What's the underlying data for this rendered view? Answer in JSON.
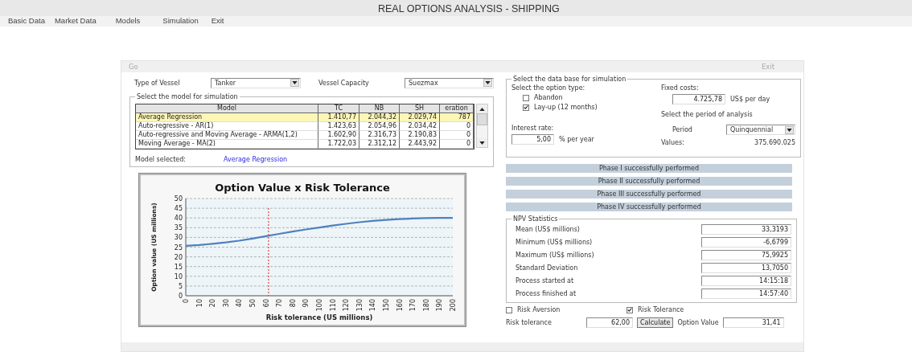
{
  "window": {
    "title": "REAL OPTIONS ANALYSIS - SHIPPING"
  },
  "menu": [
    "Basic Data",
    "Market Data",
    "Models",
    "Simulation",
    "Exit"
  ],
  "toolbar": {
    "go": "Go",
    "exit": "Exit"
  },
  "vessel": {
    "type_label": "Type of Vessel",
    "type_value": "Tanker",
    "capacity_label": "Vessel Capacity",
    "capacity_value": "Suezmax"
  },
  "model_group": {
    "title": "Select the model for simulation",
    "columns": [
      "Model",
      "TC",
      "NB",
      "SH",
      "eration"
    ],
    "rows": [
      {
        "cells": [
          "Average Regression",
          "1.410,77",
          "2.044,32",
          "2.029,74",
          "787"
        ],
        "selected": true
      },
      {
        "cells": [
          "Auto-regressive  -  AR(1)",
          "1.423,63",
          "2.054,96",
          "2.034,42",
          "0"
        ],
        "selected": false
      },
      {
        "cells": [
          "Auto-regressive and Moving Average -  ARMA(1,2)",
          "1.602,90",
          "2.316,73",
          "2.190,83",
          "0"
        ],
        "selected": false
      },
      {
        "cells": [
          "Moving Average  -  MA(2)",
          "1.722,03",
          "2.312,12",
          "2.443,92",
          "0"
        ],
        "selected": false
      }
    ],
    "selected_label": "Model selected:",
    "selected_value": "Average Regression"
  },
  "chart": {
    "chart_data": {
      "type": "line",
      "title": "Option Value x Risk Tolerance",
      "xlabel": "Risk tolerance (US millions)",
      "ylabel": "Option value (US millions)",
      "x": [
        0,
        10,
        20,
        30,
        40,
        50,
        60,
        70,
        80,
        90,
        100,
        110,
        120,
        130,
        140,
        150,
        160,
        170,
        180,
        190,
        200
      ],
      "series": [
        {
          "color": "#4f81bd",
          "values": [
            25.7,
            26.1,
            26.7,
            27.4,
            28.3,
            29.4,
            30.6,
            31.8,
            33.0,
            34.1,
            35.1,
            36.1,
            37.0,
            37.8,
            38.5,
            39.0,
            39.4,
            39.7,
            39.9,
            40.0,
            40.0
          ]
        }
      ],
      "xlim": [
        0,
        200
      ],
      "ylim": [
        0,
        50
      ],
      "xticks": [
        0,
        10,
        20,
        30,
        40,
        50,
        60,
        70,
        80,
        90,
        100,
        110,
        120,
        130,
        140,
        150,
        160,
        170,
        180,
        190,
        200
      ],
      "yticks": [
        0,
        5,
        10,
        15,
        20,
        25,
        30,
        35,
        40,
        45,
        50
      ],
      "grid": true,
      "ref_lines": [
        {
          "axis": "x",
          "value": 62,
          "color": "#e02020"
        }
      ]
    }
  },
  "database": {
    "title": "Select the data base for simulation",
    "option_type_label": "Select the option type:",
    "options": [
      {
        "label": "Abandon",
        "checked": false
      },
      {
        "label": "Lay-up (12 months)",
        "checked": true
      }
    ],
    "interest_label": "Interest rate:",
    "interest_value": "5,00",
    "interest_unit": "% per year",
    "fixed_costs_label": "Fixed costs:",
    "fixed_costs_value": "4.725,78",
    "fixed_costs_unit": "US$ per day",
    "period_heading": "Select the period of analysis",
    "period_label": "Period",
    "period_value": "Quinquennial",
    "values_label": "Values:",
    "values_value": "375.690.025"
  },
  "phases": [
    "Phase I successfully performed",
    "Phase II successfully performed",
    "Phase III successfully performed",
    "Phase IV successfully performed"
  ],
  "npv": {
    "title": "NPV Statistics",
    "rows": [
      {
        "label": "Mean (US$ millions)",
        "value": "33,3193"
      },
      {
        "label": "Minimum (US$ millions)",
        "value": "-6,6799"
      },
      {
        "label": "Maximum (US$ millions)",
        "value": "75,9925"
      },
      {
        "label": "Standard Deviation",
        "value": "13,7050"
      },
      {
        "label": "Process started at",
        "value": "14:15:18"
      },
      {
        "label": "Process finished at",
        "value": "14:57:40"
      }
    ]
  },
  "risk": {
    "options": [
      {
        "label": "Risk Aversion",
        "checked": false
      },
      {
        "label": "Risk Tolerance",
        "checked": true
      }
    ],
    "tolerance_label": "Risk tolerance",
    "tolerance_value": "62,00",
    "calculate": "Calculate",
    "option_value_label": "Option Value",
    "option_value": "31,41"
  }
}
